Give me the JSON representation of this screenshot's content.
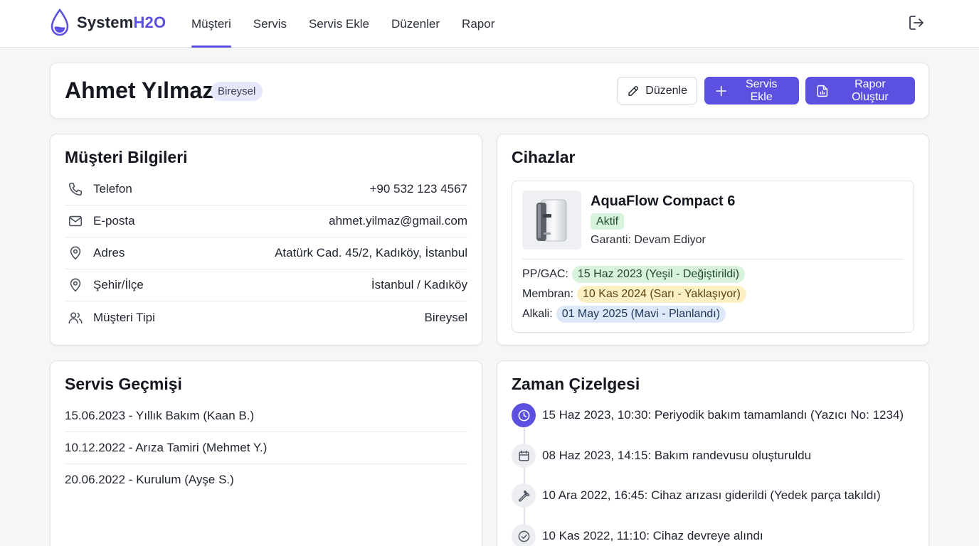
{
  "brand": {
    "part1": "System",
    "part2": "H2O",
    "accent": "#5b50e0"
  },
  "nav": {
    "items": [
      {
        "label": "Müşteri",
        "active": true
      },
      {
        "label": "Servis"
      },
      {
        "label": "Servis Ekle"
      },
      {
        "label": "Düzenler"
      },
      {
        "label": "Rapor"
      }
    ],
    "logout_icon": "logout-icon"
  },
  "customer": {
    "name": "Ahmet Yılmaz",
    "type_badge": "Bireysel",
    "actions": {
      "edit_label": "Düzenle",
      "add_service_label": "Servis Ekle",
      "create_report_label": "Rapor Oluştur"
    }
  },
  "info": {
    "title": "Müşteri Bilgileri",
    "rows": [
      {
        "icon": "phone-icon",
        "label": "Telefon",
        "value": "+90 532 123 4567"
      },
      {
        "icon": "mail-icon",
        "label": "E-posta",
        "value": "ahmet.yilmaz@gmail.com"
      },
      {
        "icon": "location-icon",
        "label": "Adres",
        "value": "Atatürk Cad. 45/2, Kadıköy, İstanbul"
      },
      {
        "icon": "location-icon",
        "label": "Şehir/İlçe",
        "value": "İstanbul / Kadıköy"
      },
      {
        "icon": "users-icon",
        "label": "Müşteri Tipi",
        "value": "Bireysel"
      }
    ]
  },
  "devices": {
    "title": "Cihazlar",
    "device": {
      "name": "AquaFlow Compact 6",
      "status": "Aktif",
      "warranty": "Garanti: Devam Ediyor",
      "filters": [
        {
          "label": "PP/GAC:",
          "value": "15 Haz 2023  (Yeşil - Değiştirildi)",
          "color": "green"
        },
        {
          "label": "Membran:",
          "value": "10 Kas 2024  (Sarı - Yaklaşıyor)",
          "color": "yellow"
        },
        {
          "label": "Alkali:",
          "value": "01 May 2025  (Mavi - Planlandı)",
          "color": "blue"
        }
      ]
    }
  },
  "history": {
    "title": "Servis Geçmişi",
    "items": [
      "15.06.2023 - Yıllık Bakım (Kaan B.)",
      "10.12.2022 - Arıza Tamiri (Mehmet Y.)",
      "20.06.2022 - Kurulum (Ayşe S.)"
    ]
  },
  "timeline": {
    "title": "Zaman Çizelgesi",
    "items": [
      {
        "icon": "clock-icon",
        "text": "15 Haz 2023, 10:30: Periyodik bakım tamamlandı (Yazıcı No: 1234)",
        "active": true
      },
      {
        "icon": "calendar-icon",
        "text": "08 Haz 2023, 14:15: Bakım randevusu oluşturuldu"
      },
      {
        "icon": "wrench-icon",
        "text": "10 Ara 2022, 16:45: Cihaz arızası giderildi (Yedek parça takıldı)"
      },
      {
        "icon": "check-circle-icon",
        "text": "10 Kas 2022, 11:10: Cihaz devreye alındı"
      }
    ]
  }
}
